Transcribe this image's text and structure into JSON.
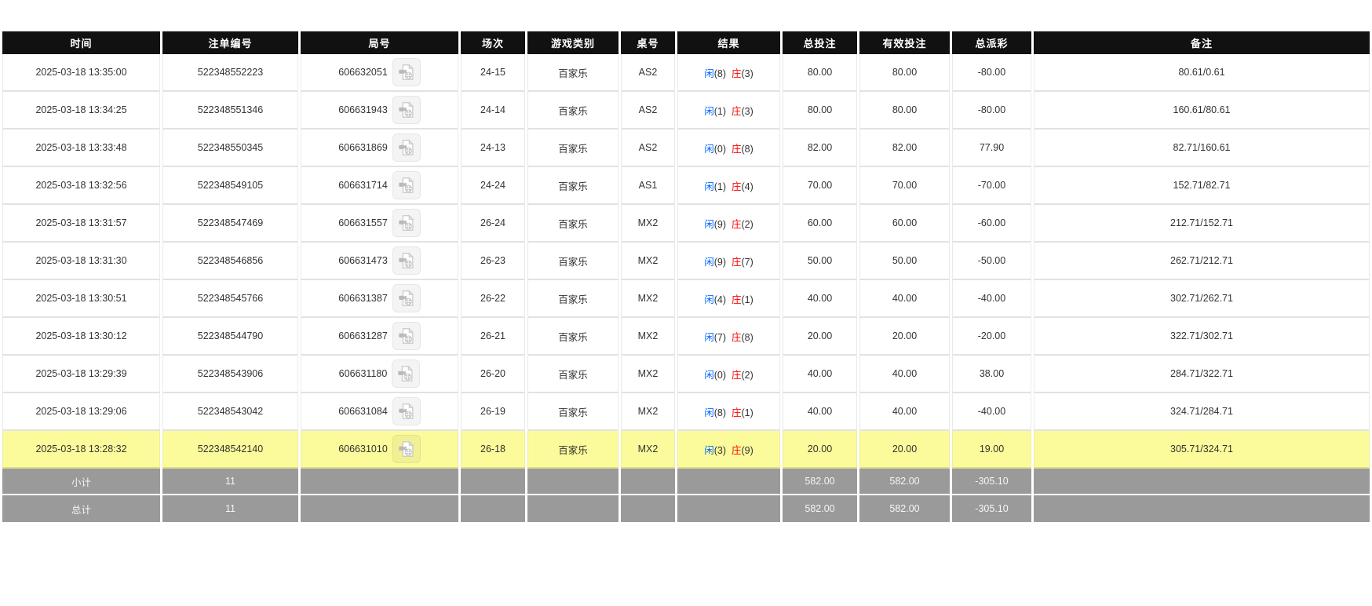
{
  "table": {
    "headers": [
      "时间",
      "注单编号",
      "局号",
      "场次",
      "游戏类别",
      "桌号",
      "结果",
      "总投注",
      "有效投注",
      "总派彩",
      "备注"
    ],
    "header_keys": [
      "time",
      "bet-id",
      "round-id",
      "session",
      "game-type",
      "table-no",
      "result",
      "total-bet",
      "valid-bet",
      "payout",
      "remark"
    ],
    "colors": {
      "header_bg": "#111111",
      "bet_blue": "#0066ff",
      "loss_red": "#ff0000",
      "highlight_yellow": "#fbfb9b",
      "summary_bg": "#9a9a9a"
    },
    "icons": {
      "round_icon": "video-replay-icon"
    },
    "rows": [
      {
        "time": "2025-03-18 13:35:00",
        "bet_id": "522348552223",
        "round_id": "606632051",
        "session": "24-15",
        "game_type": "百家乐",
        "table_no": "AS2",
        "result": {
          "player_label": "闲",
          "player_score": "(8)",
          "banker_label": "庄",
          "banker_score": "(3)"
        },
        "total_bet": "80.00",
        "valid_bet": "80.00",
        "payout": "-80.00",
        "remark": "80.61/0.61",
        "highlighted": false
      },
      {
        "time": "2025-03-18 13:34:25",
        "bet_id": "522348551346",
        "round_id": "606631943",
        "session": "24-14",
        "game_type": "百家乐",
        "table_no": "AS2",
        "result": {
          "player_label": "闲",
          "player_score": "(1)",
          "banker_label": "庄",
          "banker_score": "(3)"
        },
        "total_bet": "80.00",
        "valid_bet": "80.00",
        "payout": "-80.00",
        "remark": "160.61/80.61",
        "highlighted": false
      },
      {
        "time": "2025-03-18 13:33:48",
        "bet_id": "522348550345",
        "round_id": "606631869",
        "session": "24-13",
        "game_type": "百家乐",
        "table_no": "AS2",
        "result": {
          "player_label": "闲",
          "player_score": "(0)",
          "banker_label": "庄",
          "banker_score": "(8)"
        },
        "total_bet": "82.00",
        "valid_bet": "82.00",
        "payout": "77.90",
        "remark": "82.71/160.61",
        "highlighted": false
      },
      {
        "time": "2025-03-18 13:32:56",
        "bet_id": "522348549105",
        "round_id": "606631714",
        "session": "24-24",
        "game_type": "百家乐",
        "table_no": "AS1",
        "result": {
          "player_label": "闲",
          "player_score": "(1)",
          "banker_label": "庄",
          "banker_score": "(4)"
        },
        "total_bet": "70.00",
        "valid_bet": "70.00",
        "payout": "-70.00",
        "remark": "152.71/82.71",
        "highlighted": false
      },
      {
        "time": "2025-03-18 13:31:57",
        "bet_id": "522348547469",
        "round_id": "606631557",
        "session": "26-24",
        "game_type": "百家乐",
        "table_no": "MX2",
        "result": {
          "player_label": "闲",
          "player_score": "(9)",
          "banker_label": "庄",
          "banker_score": "(2)"
        },
        "total_bet": "60.00",
        "valid_bet": "60.00",
        "payout": "-60.00",
        "remark": "212.71/152.71",
        "highlighted": false
      },
      {
        "time": "2025-03-18 13:31:30",
        "bet_id": "522348546856",
        "round_id": "606631473",
        "session": "26-23",
        "game_type": "百家乐",
        "table_no": "MX2",
        "result": {
          "player_label": "闲",
          "player_score": "(9)",
          "banker_label": "庄",
          "banker_score": "(7)"
        },
        "total_bet": "50.00",
        "valid_bet": "50.00",
        "payout": "-50.00",
        "remark": "262.71/212.71",
        "highlighted": false
      },
      {
        "time": "2025-03-18 13:30:51",
        "bet_id": "522348545766",
        "round_id": "606631387",
        "session": "26-22",
        "game_type": "百家乐",
        "table_no": "MX2",
        "result": {
          "player_label": "闲",
          "player_score": "(4)",
          "banker_label": "庄",
          "banker_score": "(1)"
        },
        "total_bet": "40.00",
        "valid_bet": "40.00",
        "payout": "-40.00",
        "remark": "302.71/262.71",
        "highlighted": false
      },
      {
        "time": "2025-03-18 13:30:12",
        "bet_id": "522348544790",
        "round_id": "606631287",
        "session": "26-21",
        "game_type": "百家乐",
        "table_no": "MX2",
        "result": {
          "player_label": "闲",
          "player_score": "(7)",
          "banker_label": "庄",
          "banker_score": "(8)"
        },
        "total_bet": "20.00",
        "valid_bet": "20.00",
        "payout": "-20.00",
        "remark": "322.71/302.71",
        "highlighted": false
      },
      {
        "time": "2025-03-18 13:29:39",
        "bet_id": "522348543906",
        "round_id": "606631180",
        "session": "26-20",
        "game_type": "百家乐",
        "table_no": "MX2",
        "result": {
          "player_label": "闲",
          "player_score": "(0)",
          "banker_label": "庄",
          "banker_score": "(2)"
        },
        "total_bet": "40.00",
        "valid_bet": "40.00",
        "payout": "38.00",
        "remark": "284.71/322.71",
        "highlighted": false
      },
      {
        "time": "2025-03-18 13:29:06",
        "bet_id": "522348543042",
        "round_id": "606631084",
        "session": "26-19",
        "game_type": "百家乐",
        "table_no": "MX2",
        "result": {
          "player_label": "闲",
          "player_score": "(8)",
          "banker_label": "庄",
          "banker_score": "(1)"
        },
        "total_bet": "40.00",
        "valid_bet": "40.00",
        "payout": "-40.00",
        "remark": "324.71/284.71",
        "highlighted": false
      },
      {
        "time": "2025-03-18 13:28:32",
        "bet_id": "522348542140",
        "round_id": "606631010",
        "session": "26-18",
        "game_type": "百家乐",
        "table_no": "MX2",
        "result": {
          "player_label": "闲",
          "player_score": "(3)",
          "banker_label": "庄",
          "banker_score": "(9)"
        },
        "total_bet": "20.00",
        "valid_bet": "20.00",
        "payout": "19.00",
        "remark": "305.71/324.71",
        "highlighted": true
      }
    ],
    "summary": [
      {
        "label": "小计",
        "count": "11",
        "total_bet": "582.00",
        "valid_bet": "582.00",
        "payout": "-305.10"
      },
      {
        "label": "总计",
        "count": "11",
        "total_bet": "582.00",
        "valid_bet": "582.00",
        "payout": "-305.10"
      }
    ]
  }
}
